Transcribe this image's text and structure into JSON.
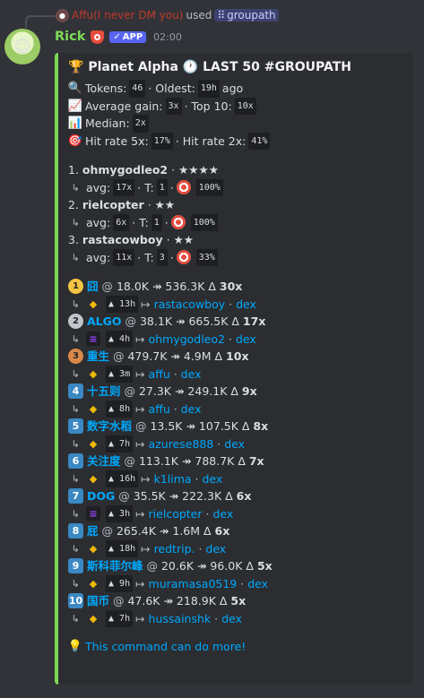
{
  "reply": {
    "user": "Affu(I never DM you)",
    "used": "used",
    "command": "groupath"
  },
  "message": {
    "username": "Rick",
    "badge": "APP",
    "time": "02:00"
  },
  "colors": {
    "accent": "#7ed957",
    "link": "#00a8fc",
    "app_badge": "#5865f2"
  },
  "embed": {
    "title": "Planet Alpha",
    "title_suffix": "LAST 50 #GROUPATH",
    "stats": {
      "tokens_label": "Tokens:",
      "tokens": "46",
      "oldest_label": "· Oldest:",
      "oldest": "19h",
      "oldest_suffix": "ago",
      "avg_label": "Average gain:",
      "avg": "3x",
      "top10_label": "· Top 10:",
      "top10": "10x",
      "median_label": "Median:",
      "median": "2x",
      "hit5_label": "Hit rate 5x:",
      "hit5": "17%",
      "hit2_label": "· Hit rate 2x:",
      "hit2": "41%"
    },
    "callers": [
      {
        "rank": "1.",
        "name": "ohmygodleo2",
        "stars": "★★★★",
        "avg": "17x",
        "t": "1",
        "pct": "100%"
      },
      {
        "rank": "2.",
        "name": "rielcopter",
        "stars": "★★",
        "avg": "6x",
        "t": "1",
        "pct": "100%"
      },
      {
        "rank": "3.",
        "name": "rastacowboy",
        "stars": "★★",
        "avg": "11x",
        "t": "3",
        "pct": "33%"
      }
    ],
    "caller_labels": {
      "avg": "avg:",
      "t": "· T:",
      "sep": "·"
    },
    "tokens": [
      {
        "rank": "1",
        "name": "囧",
        "from": "18.0K",
        "to": "536.3K",
        "mult": "30x",
        "chain": "bnb",
        "age": "13h",
        "caller": "rastacowboy",
        "dex": "dex"
      },
      {
        "rank": "2",
        "name": "ALGO",
        "from": "38.1K",
        "to": "665.5K",
        "mult": "17x",
        "chain": "sol",
        "age": "4h",
        "caller": "ohmygodleo2",
        "dex": "dex"
      },
      {
        "rank": "3",
        "name": "重生",
        "from": "479.7K",
        "to": "4.9M",
        "mult": "10x",
        "chain": "bnb",
        "age": "3m",
        "caller": "affu",
        "dex": "dex"
      },
      {
        "rank": "4",
        "name": "十五则",
        "from": "27.3K",
        "to": "249.1K",
        "mult": "9x",
        "chain": "bnb",
        "age": "8h",
        "caller": "affu",
        "dex": "dex"
      },
      {
        "rank": "5",
        "name": "数字水稻",
        "from": "13.5K",
        "to": "107.5K",
        "mult": "8x",
        "chain": "bnb",
        "age": "7h",
        "caller": "azurese888",
        "dex": "dex"
      },
      {
        "rank": "6",
        "name": "关注度",
        "from": "113.1K",
        "to": "788.7K",
        "mult": "7x",
        "chain": "bnb",
        "age": "16h",
        "caller": "k1lima",
        "dex": "dex"
      },
      {
        "rank": "7",
        "name": "DOG",
        "from": "35.5K",
        "to": "222.3K",
        "mult": "6x",
        "chain": "sol",
        "age": "3h",
        "caller": "rielcopter",
        "dex": "dex"
      },
      {
        "rank": "8",
        "name": "屁",
        "from": "265.4K",
        "to": "1.6M",
        "mult": "6x",
        "chain": "bnb",
        "age": "18h",
        "caller": "redtrip.",
        "dex": "dex"
      },
      {
        "rank": "9",
        "name": "斯科菲尔峰",
        "from": "20.6K",
        "to": "96.0K",
        "mult": "5x",
        "chain": "bnb",
        "age": "9h",
        "caller": "muramasa0519",
        "dex": "dex"
      },
      {
        "rank": "10",
        "name": "国币",
        "from": "47.6K",
        "to": "218.9K",
        "mult": "5x",
        "chain": "bnb",
        "age": "7h",
        "caller": "hussainshk",
        "dex": "dex"
      }
    ],
    "footer": "This command can do more!"
  }
}
